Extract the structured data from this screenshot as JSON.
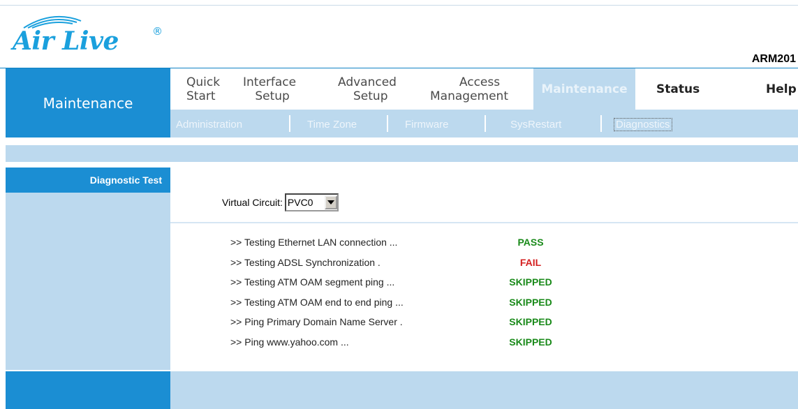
{
  "logo": {
    "text": "Air Live",
    "reg": "®",
    "color": "#1aa0dd"
  },
  "model": "ARM201",
  "section_title": "Maintenance",
  "main_nav": [
    {
      "line1": "Quick",
      "line2": "Start"
    },
    {
      "line1": "Interface",
      "line2": "Setup"
    },
    {
      "line1": "Advanced",
      "line2": "Setup"
    },
    {
      "line1": "Access",
      "line2": "Management"
    },
    {
      "label": "Maintenance",
      "active": true
    },
    {
      "label": "Status"
    },
    {
      "label": "Help"
    }
  ],
  "sub_nav": [
    "Administration",
    "Time Zone",
    "Firmware",
    "SysRestart",
    "Diagnostics"
  ],
  "sub_nav_active": "Diagnostics",
  "left_title": "Diagnostic Test",
  "virtual_circuit": {
    "label": "Virtual Circuit:",
    "value": "PVC0"
  },
  "tests": [
    {
      "label": ">> Testing Ethernet LAN connection ...",
      "result": "PASS",
      "color": "#1a8a1a"
    },
    {
      "label": ">> Testing ADSL Synchronization .",
      "result": "FAIL",
      "color": "#d42020"
    },
    {
      "label": ">> Testing ATM OAM segment ping ...",
      "result": "SKIPPED",
      "color": "#1a8a1a"
    },
    {
      "label": ">> Testing ATM OAM end to end ping ...",
      "result": "SKIPPED",
      "color": "#1a8a1a"
    },
    {
      "label": ">> Ping Primary Domain Name Server .",
      "result": "SKIPPED",
      "color": "#1a8a1a"
    },
    {
      "label": ">> Ping www.yahoo.com ...",
      "result": "SKIPPED",
      "color": "#1a8a1a"
    }
  ],
  "colors": {
    "primary": "#1b8ed3",
    "light": "#bcd9ee"
  }
}
